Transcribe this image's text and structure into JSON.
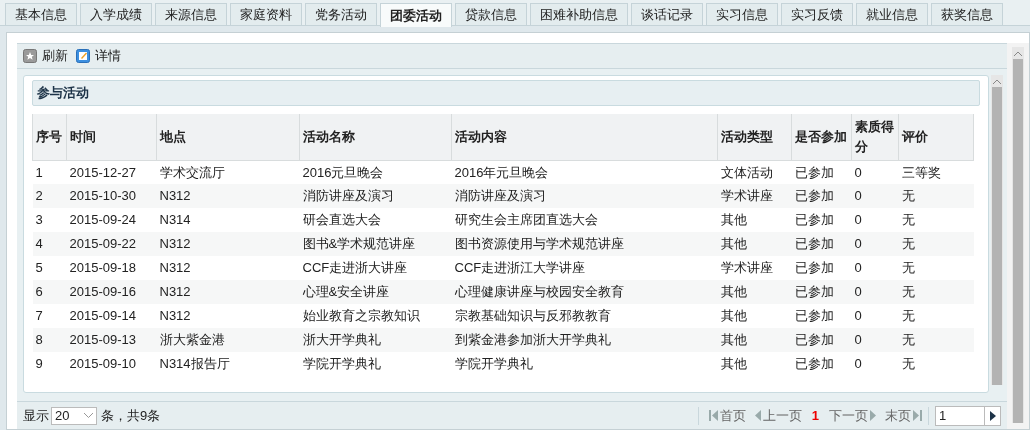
{
  "tabs": [
    {
      "label": "基本信息",
      "selected": false
    },
    {
      "label": "入学成绩",
      "selected": false
    },
    {
      "label": "来源信息",
      "selected": false
    },
    {
      "label": "家庭资料",
      "selected": false
    },
    {
      "label": "党务活动",
      "selected": false
    },
    {
      "label": "团委活动",
      "selected": true
    },
    {
      "label": "贷款信息",
      "selected": false
    },
    {
      "label": "困难补助信息",
      "selected": false
    },
    {
      "label": "谈话记录",
      "selected": false
    },
    {
      "label": "实习信息",
      "selected": false
    },
    {
      "label": "实习反馈",
      "selected": false
    },
    {
      "label": "就业信息",
      "selected": false
    },
    {
      "label": "获奖信息",
      "selected": false
    }
  ],
  "toolbar": [
    {
      "label": "刷新",
      "kind": "refresh"
    },
    {
      "label": "详情",
      "kind": "edit"
    }
  ],
  "panel": {
    "title": "参与活动",
    "table": {
      "columns": [
        "序号",
        "时间",
        "地点",
        "活动名称",
        "活动内容",
        "活动类型",
        "是否参加",
        "素质得分",
        "评价"
      ],
      "rows": [
        [
          "1",
          "2015-12-27",
          "学术交流厅",
          "2016元旦晚会",
          "2016年元旦晚会",
          "文体活动",
          "已参加",
          "0",
          "三等奖"
        ],
        [
          "2",
          "2015-10-30",
          "N312",
          "消防讲座及演习",
          "消防讲座及演习",
          "学术讲座",
          "已参加",
          "0",
          "无"
        ],
        [
          "3",
          "2015-09-24",
          "N314",
          "研会直选大会",
          "研究生会主席团直选大会",
          "其他",
          "已参加",
          "0",
          "无"
        ],
        [
          "4",
          "2015-09-22",
          "N312",
          "图书&学术规范讲座",
          "图书资源使用与学术规范讲座",
          "其他",
          "已参加",
          "0",
          "无"
        ],
        [
          "5",
          "2015-09-18",
          "N312",
          "CCF走进浙大讲座",
          "CCF走进浙江大学讲座",
          "学术讲座",
          "已参加",
          "0",
          "无"
        ],
        [
          "6",
          "2015-09-16",
          "N312",
          "心理&安全讲座",
          "心理健康讲座与校园安全教育",
          "其他",
          "已参加",
          "0",
          "无"
        ],
        [
          "7",
          "2015-09-14",
          "N312",
          "始业教育之宗教知识",
          "宗教基础知识与反邪教教育",
          "其他",
          "已参加",
          "0",
          "无"
        ],
        [
          "8",
          "2015-09-13",
          "浙大紫金港",
          "浙大开学典礼",
          "到紫金港参加浙大开学典礼",
          "其他",
          "已参加",
          "0",
          "无"
        ],
        [
          "9",
          "2015-09-10",
          "N314报告厅",
          "学院开学典礼",
          "学院开学典礼",
          "其他",
          "已参加",
          "0",
          "无"
        ]
      ]
    }
  },
  "footer": {
    "show_label": "显示",
    "page_size": "20",
    "total": "条，共9条",
    "first": "首页",
    "prev": "上一页",
    "current_page": "1",
    "next": "下一页",
    "last": "末页",
    "goto_value": "1"
  }
}
